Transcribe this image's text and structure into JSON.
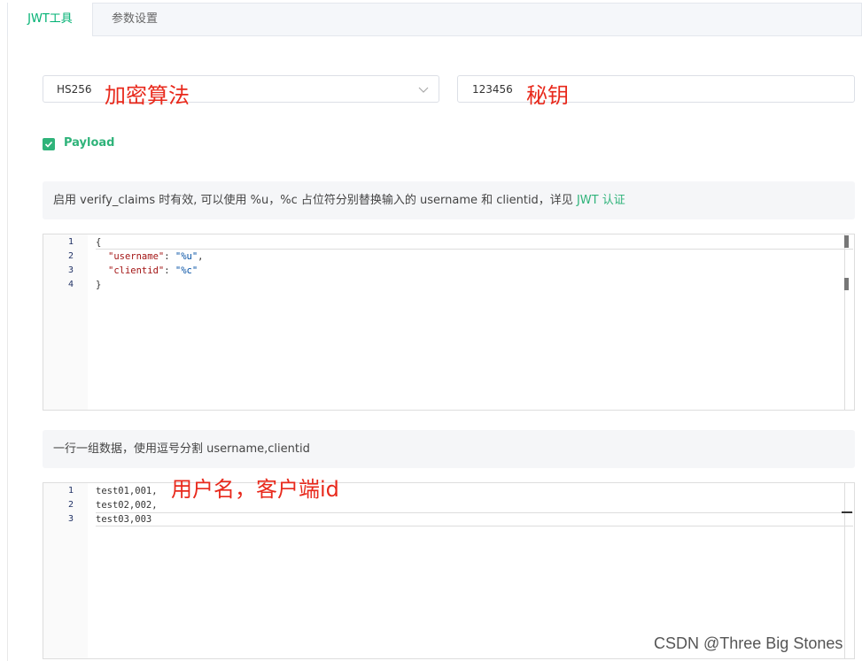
{
  "tabs": [
    {
      "label": "JWT工具"
    },
    {
      "label": "参数设置"
    }
  ],
  "algorithm": {
    "value": "HS256",
    "annotation": "加密算法"
  },
  "secret": {
    "value": "123456",
    "annotation": "秘钥"
  },
  "payload_checkbox": {
    "label": "Payload",
    "checked": true
  },
  "tip1": {
    "text": "启用 verify_claims 时有效, 可以使用 %u，%c 占位符分别替换输入的 username 和 clientid，详见 ",
    "link": "JWT 认证"
  },
  "claims_editor": {
    "lines": [
      {
        "num": "1",
        "text": "{"
      },
      {
        "num": "2",
        "key": "\"username\"",
        "sep": ": ",
        "val": "\"%u\"",
        "end": ","
      },
      {
        "num": "3",
        "key": "\"clientid\"",
        "sep": ": ",
        "val": "\"%c\"",
        "end": ""
      },
      {
        "num": "4",
        "text": "}"
      }
    ]
  },
  "tip2": {
    "text": "一行一组数据，使用逗号分割 username,clientid"
  },
  "data_editor": {
    "annotation": "用户名，客户端id",
    "lines": [
      {
        "num": "1",
        "text": "test01,001,"
      },
      {
        "num": "2",
        "text": "test02,002,"
      },
      {
        "num": "3",
        "text": "test03,003"
      }
    ]
  },
  "watermark": "CSDN @Three Big Stones",
  "colors": {
    "accent": "#2fb37a",
    "annotation": "#e8291c"
  }
}
